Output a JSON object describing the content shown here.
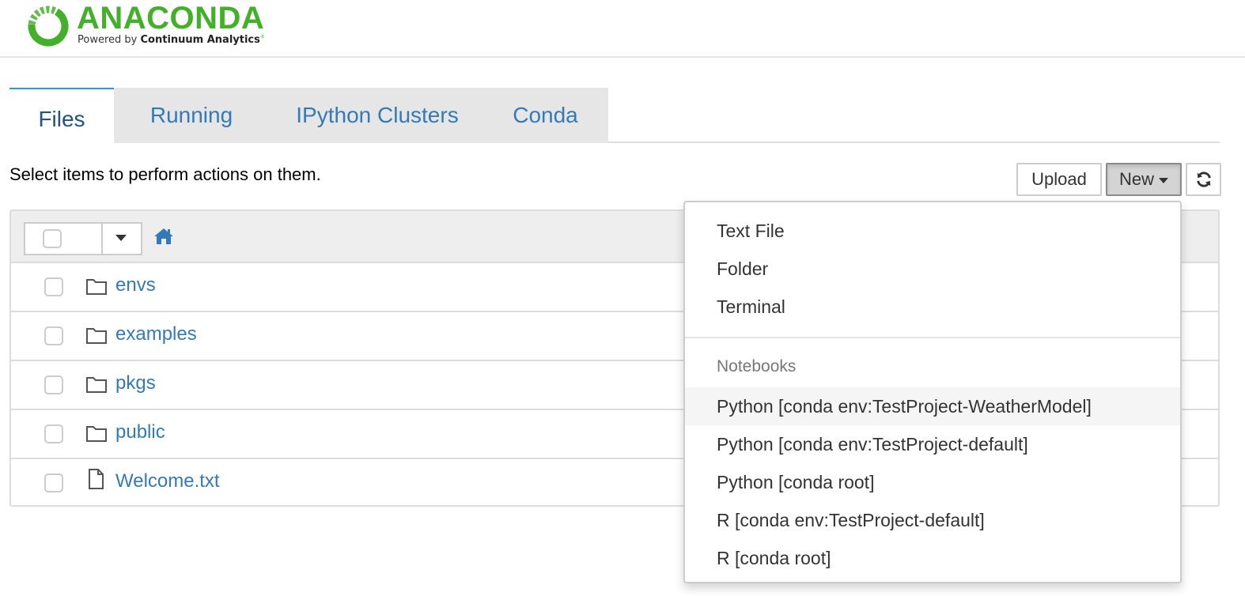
{
  "logo": {
    "title": "ANACONDA",
    "subtitle_prefix": "Powered by",
    "subtitle_brand": "Continuum Analytics",
    "registered": "®",
    "brand_color": "#43b02a"
  },
  "tabs": [
    {
      "label": "Files",
      "active": true
    },
    {
      "label": "Running",
      "active": false
    },
    {
      "label": "IPython Clusters",
      "active": false
    },
    {
      "label": "Conda",
      "active": false
    }
  ],
  "toolbar": {
    "instructions": "Select items to perform actions on them.",
    "upload_label": "Upload",
    "new_label": "New",
    "refresh_icon": "refresh-icon"
  },
  "file_list": {
    "home_icon": "home-icon",
    "items": [
      {
        "name": "envs",
        "type": "folder"
      },
      {
        "name": "examples",
        "type": "folder"
      },
      {
        "name": "pkgs",
        "type": "folder"
      },
      {
        "name": "public",
        "type": "folder"
      },
      {
        "name": "Welcome.txt",
        "type": "file"
      }
    ]
  },
  "new_menu": {
    "items": [
      "Text File",
      "Folder",
      "Terminal"
    ],
    "notebooks_header": "Notebooks",
    "notebooks": [
      {
        "label": "Python [conda env:TestProject-WeatherModel]",
        "hovered": true
      },
      {
        "label": "Python [conda env:TestProject-default]",
        "hovered": false
      },
      {
        "label": "Python [conda root]",
        "hovered": false
      },
      {
        "label": "R [conda env:TestProject-default]",
        "hovered": false
      },
      {
        "label": "R [conda root]",
        "hovered": false
      }
    ]
  },
  "colors": {
    "link": "#337ab7",
    "active_tab_border": "#2a9fd6",
    "tab_bg": "#e6e6e6"
  }
}
